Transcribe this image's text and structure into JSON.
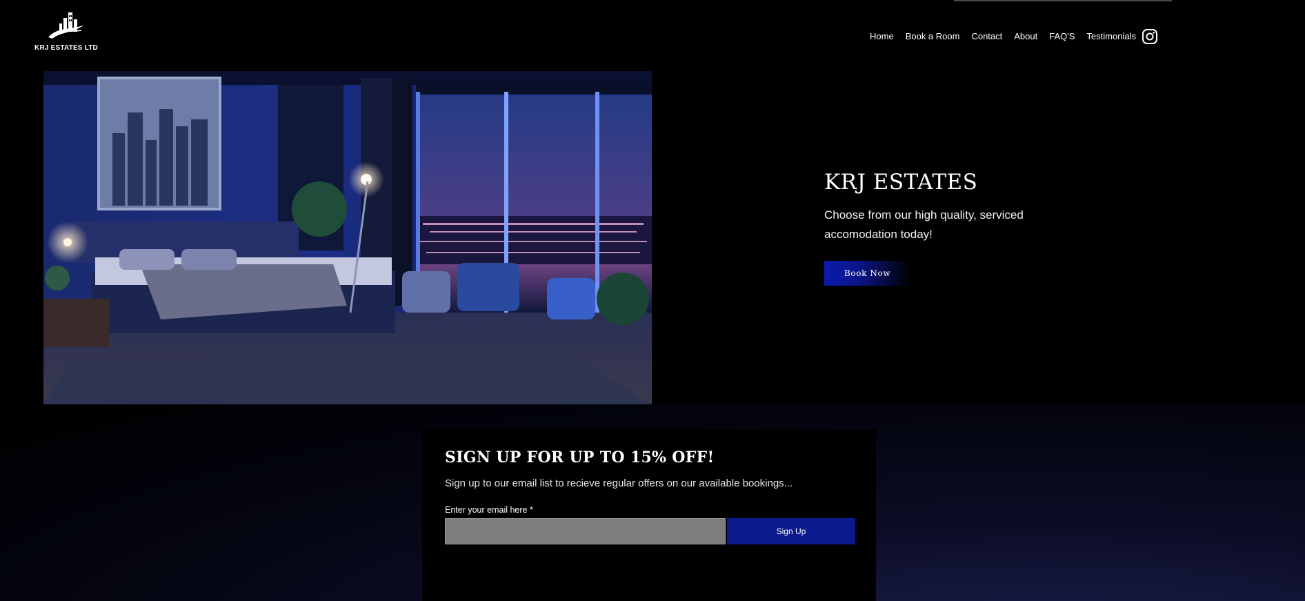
{
  "brand": {
    "name": "KRJ ESTATES LTD"
  },
  "nav": {
    "items": [
      "Home",
      "Book a Room",
      "Contact",
      "About",
      "FAQ'S",
      "Testimonials"
    ],
    "social_icon": "instagram-icon"
  },
  "hero": {
    "title": "KRJ ESTATES",
    "subtitle": "Choose from our high quality, serviced accomodation today!",
    "button": "Book Now"
  },
  "signup": {
    "title": "SIGN UP FOR UP TO 15% OFF!",
    "subtitle": "Sign up to our email list to recieve regular offers on our available bookings...",
    "email_label": "Enter your email here *",
    "email_value": "",
    "button": "Sign Up"
  },
  "colors": {
    "background": "#000000",
    "accent_blue": "#0b1a8c",
    "input_gray": "#7d7d7d"
  }
}
